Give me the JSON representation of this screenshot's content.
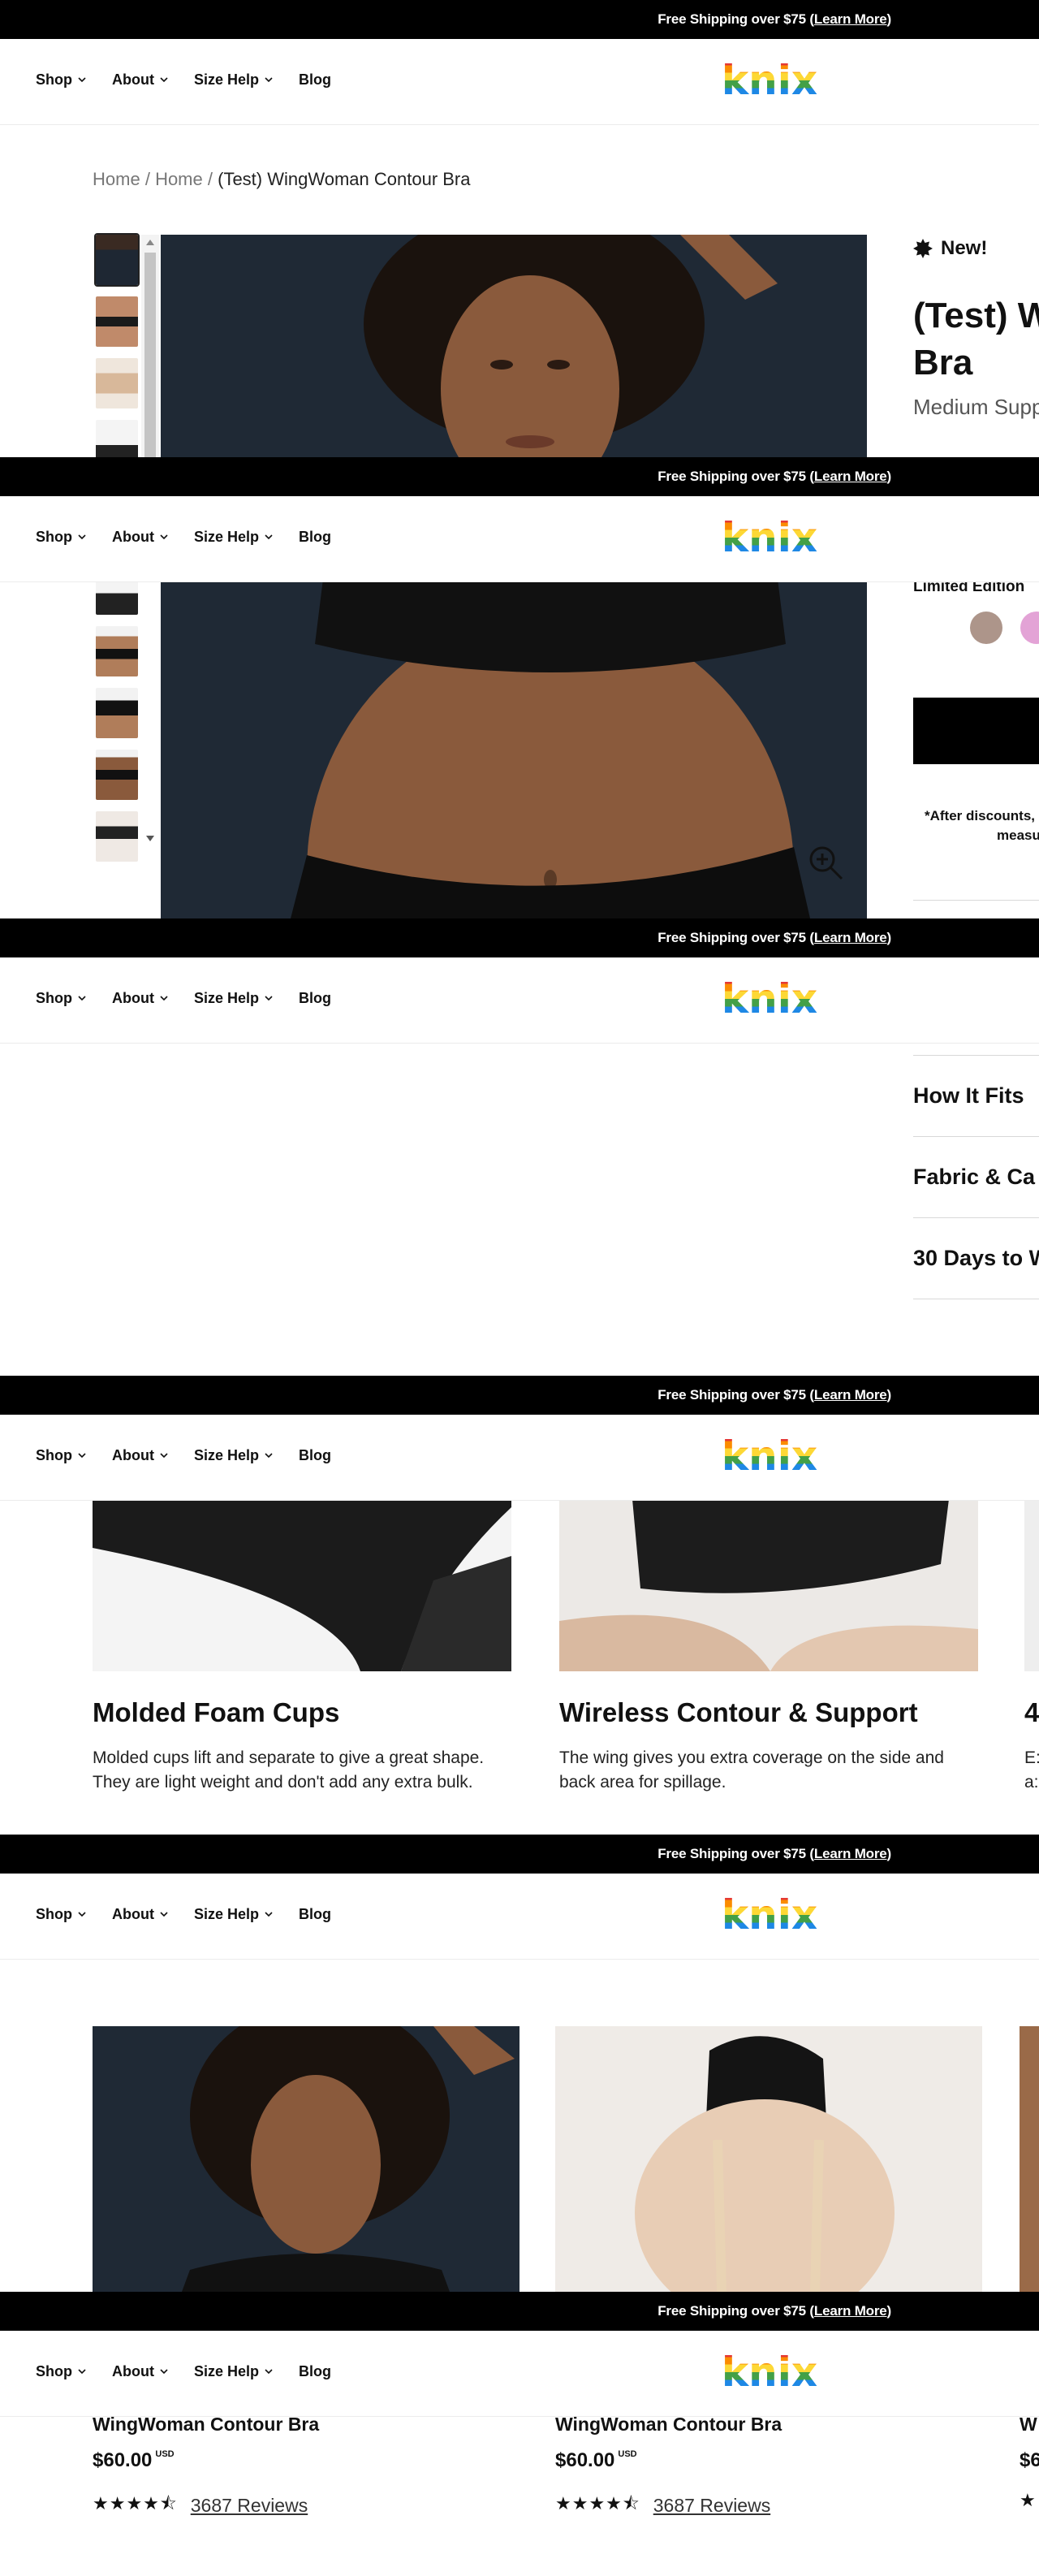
{
  "promo": {
    "prefix": "Free Shipping over $75 (",
    "link": "Learn More",
    "suffix": ")"
  },
  "nav": {
    "shop": "Shop",
    "about": "About",
    "size_help": "Size Help",
    "blog": "Blog",
    "logo": "knix"
  },
  "breadcrumb": {
    "home1": "Home",
    "home2": "Home",
    "sep": "/",
    "current": "(Test) WingWoman Contour Bra"
  },
  "product": {
    "badge": "New!",
    "title_line1": "(Test) W",
    "title_line2": "Bra",
    "subtitle": "Medium Suppo",
    "limited": "Limited Edition",
    "swatch_colors": [
      "#ad958a",
      "#e3a3d6"
    ],
    "disclaimer_line1": "*After discounts,",
    "disclaimer_line2": "measu"
  },
  "accordion": [
    "How It Fits",
    "Fabric & Ca",
    "30 Days to W"
  ],
  "features": [
    {
      "title": "Molded Foam Cups",
      "text": "Molded cups lift and separate to give a great shape. They are light weight and don't add any extra bulk."
    },
    {
      "title": "Wireless Contour & Support",
      "text": "The wing gives you extra coverage on the side and back area for spillage."
    },
    {
      "title": "4",
      "text": "E: a:"
    }
  ],
  "related": [
    {
      "name": "WingWoman Contour Bra",
      "price": "$60.00",
      "currency": "USD",
      "reviews": "3687 Reviews",
      "rating": 4.5
    },
    {
      "name": "WingWoman Contour Bra",
      "price": "$60.00",
      "currency": "USD",
      "reviews": "3687 Reviews",
      "rating": 4.5
    },
    {
      "name": "W",
      "price": "$6",
      "currency": "",
      "reviews": "",
      "rating": 4.5
    }
  ],
  "icons": {
    "zoom": "zoom-in-icon",
    "chevron": "chevron-down-icon",
    "star": "star-icon",
    "burst": "burst-icon"
  }
}
